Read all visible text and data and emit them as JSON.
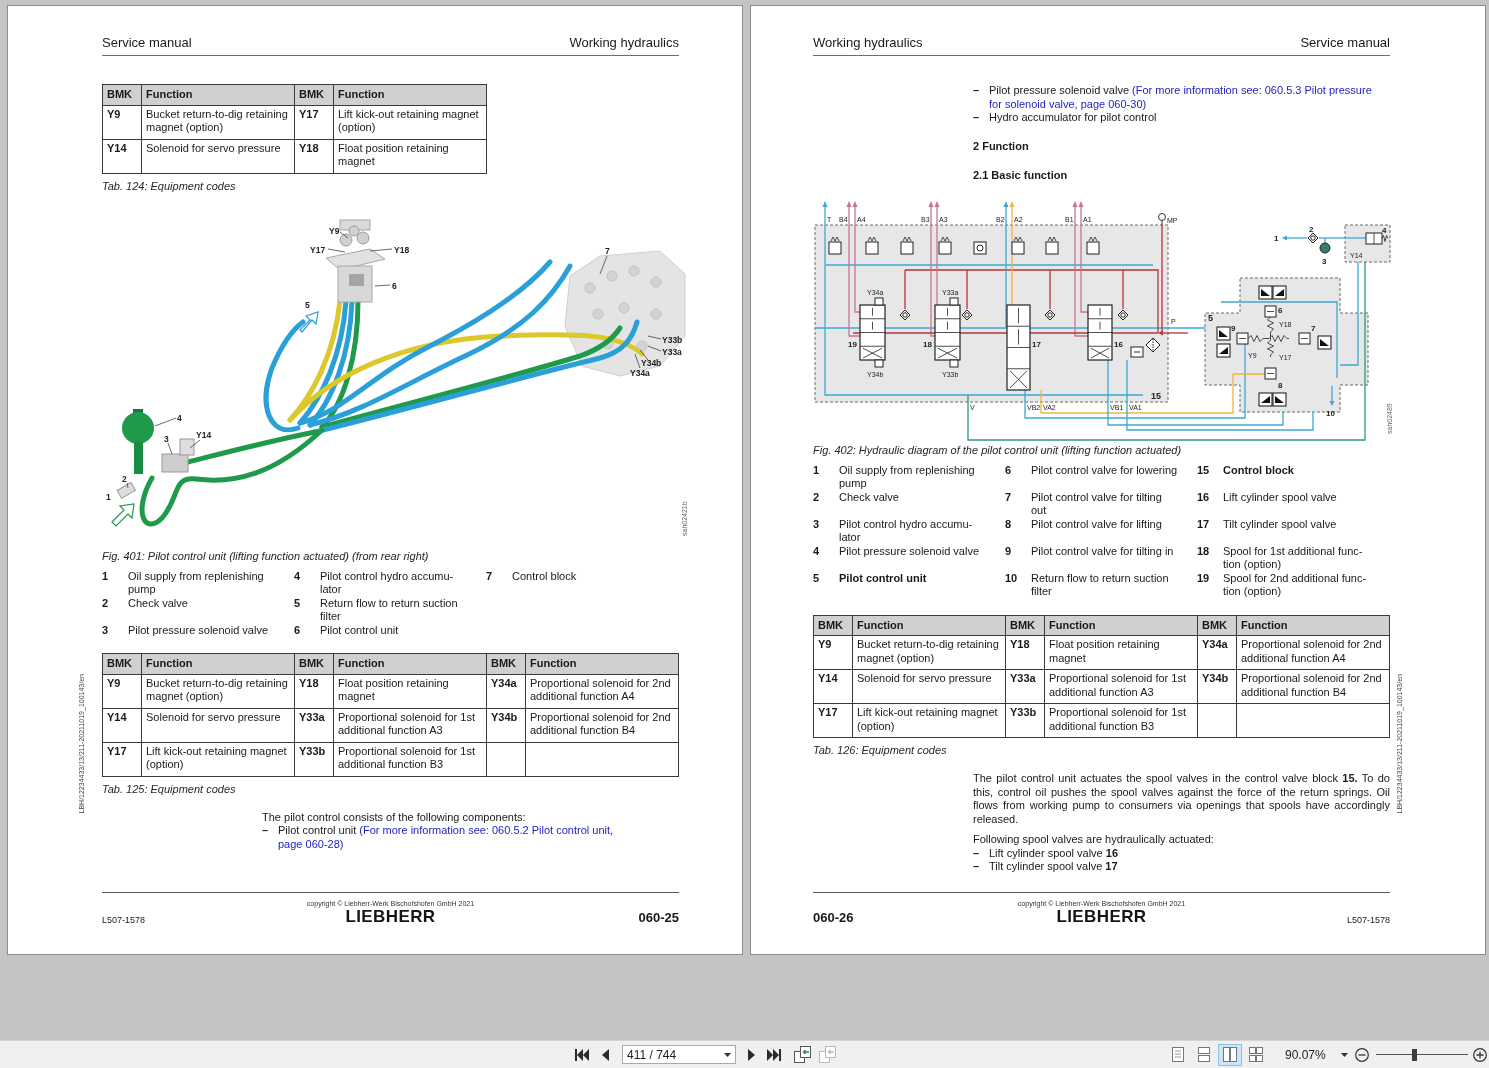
{
  "pages": [
    {
      "header": {
        "left": "Service manual",
        "right": "Working hydraulics"
      },
      "blocks": [
        {
          "kind": "table",
          "columns": [
            "BMK",
            "Function",
            "BMK",
            "Function"
          ],
          "rows": [
            [
              "Y9",
              "Bucket return-to-dig retaining magnet (option)",
              "Y17",
              "Lift kick-out retaining magnet (option)"
            ],
            [
              "Y14",
              "Solenoid for servo pressure",
              "Y18",
              "Float position retaining magnet"
            ]
          ]
        },
        {
          "kind": "caption",
          "text": "Tab. 124: Equipment codes"
        },
        {
          "kind": "illustration",
          "labels": [
            "1",
            "2",
            "3",
            "4",
            "5",
            "6",
            "7",
            "Y9",
            "Y14",
            "Y17",
            "Y18",
            "Y33a",
            "Y33b",
            "Y34a",
            "Y34b"
          ],
          "figure_id": "sah02421b"
        },
        {
          "kind": "caption",
          "text": "Fig. 401: Pilot control unit (lifting function actuated) (from rear right)"
        },
        {
          "kind": "legend",
          "columns": [
            [
              {
                "number": "1",
                "text": "Oil supply from replenishing pump",
                "bold": false
              },
              {
                "number": "2",
                "text": "Check valve",
                "bold": false
              },
              {
                "number": "3",
                "text": "Pilot pressure solenoid valve",
                "bold": false
              }
            ],
            [
              {
                "number": "4",
                "text": "Pilot control hydro accumu-lator",
                "bold": false
              },
              {
                "number": "5",
                "text": "Return flow to return suction filter",
                "bold": false
              },
              {
                "number": "6",
                "text": "Pilot control unit",
                "bold": false
              }
            ],
            [
              {
                "number": "7",
                "text": "Control block",
                "bold": false
              }
            ]
          ]
        },
        {
          "kind": "table",
          "columns": [
            "BMK",
            "Function",
            "BMK",
            "Function",
            "BMK",
            "Function"
          ],
          "rows": [
            [
              "Y9",
              "Bucket return-to-dig retaining magnet (option)",
              "Y18",
              "Float position retaining magnet",
              "Y34a",
              "Proportional solenoid for 2nd additional function A4"
            ],
            [
              "Y14",
              "Solenoid for servo pressure",
              "Y33a",
              "Proportional solenoid for 1st additional function A3",
              "Y34b",
              "Proportional solenoid for 2nd additional function B4"
            ],
            [
              "Y17",
              "Lift kick-out retaining magnet (option)",
              "Y33b",
              "Proportional solenoid for 1st additional function B3"
            ]
          ]
        },
        {
          "kind": "caption",
          "text": "Tab. 125: Equipment codes"
        },
        {
          "kind": "paragraph",
          "text": "The pilot control consists of the following components:"
        },
        {
          "kind": "bullets",
          "marker": "–",
          "items": [
            {
              "text": "Pilot control unit",
              "link_lines": [
                "(For more information see: 060.5.2 Pilot control unit,",
                "page 060-28)"
              ]
            }
          ]
        }
      ],
      "footer": {
        "copyright": "copyright © Liebherr-Werk Bischofshofen GmbH 2021",
        "logo": "LIEBHERR",
        "doc_number": "L507-1578",
        "page_number": "060-25"
      },
      "margin_note": "LBH/12234433/13/211-20211019_100143/en"
    },
    {
      "header": {
        "left": "Working hydraulics",
        "right": "Service manual"
      },
      "blocks": [
        {
          "kind": "bullets",
          "marker": "–",
          "items": [
            {
              "text": "Pilot pressure solenoid valve",
              "link_lines": [
                "(For more information see: 060.5.3 Pilot pressure",
                "for solenoid valve, page 060-30)"
              ]
            },
            {
              "text": "Hydro accumulator for pilot control"
            }
          ]
        },
        {
          "kind": "heading",
          "text": "2 Function"
        },
        {
          "kind": "heading",
          "text": "2.1 Basic function"
        },
        {
          "kind": "schematic",
          "labels": [
            "T",
            "B4",
            "A4",
            "B3",
            "A3",
            "B2",
            "A2",
            "B1",
            "A1",
            "MP",
            "Y34a",
            "Y33a",
            "19",
            "18",
            "17",
            "16",
            "P",
            "Y34b",
            "Y33b",
            "15",
            "V",
            "VB2",
            "VA2",
            "VB1",
            "VA1",
            "1",
            "2",
            "3",
            "4",
            "Y14",
            "5",
            "6",
            "Y18",
            "7",
            "8",
            "9",
            "Y9",
            "Y17",
            "10"
          ],
          "figure_id": "sah02489"
        },
        {
          "kind": "caption",
          "text": "Fig. 402: Hydraulic diagram of the pilot control unit (lifting function actuated)"
        },
        {
          "kind": "legend",
          "columns": [
            [
              {
                "number": "1",
                "text": "Oil supply from replenishing pump",
                "bold": false
              },
              {
                "number": "2",
                "text": "Check valve",
                "bold": false
              },
              {
                "number": "3",
                "text": "Pilot control hydro accumu-lator",
                "bold": false
              },
              {
                "number": "4",
                "text": "Pilot pressure solenoid valve",
                "bold": false
              },
              {
                "number": "5",
                "text": "Pilot control unit",
                "bold": true
              }
            ],
            [
              {
                "number": "6",
                "text": "Pilot control valve for lowering",
                "bold": false
              },
              {
                "number": "7",
                "text": "Pilot control valve for tilting out",
                "bold": false
              },
              {
                "number": "8",
                "text": "Pilot control valve for lifting",
                "bold": false
              },
              {
                "number": "9",
                "text": "Pilot control valve for tilting in",
                "bold": false
              },
              {
                "number": "10",
                "text": "Return flow to return suction filter",
                "bold": false
              }
            ],
            [
              {
                "number": "15",
                "text": "Control block",
                "bold": true
              },
              {
                "number": "16",
                "text": "Lift cylinder spool valve",
                "bold": false
              },
              {
                "number": "17",
                "text": "Tilt cylinder spool valve",
                "bold": false
              },
              {
                "number": "18",
                "text": "Spool for 1st additional func-tion (option)",
                "bold": false
              },
              {
                "number": "19",
                "text": "Spool for 2nd additional func-tion (option)",
                "bold": false
              }
            ]
          ]
        },
        {
          "kind": "table",
          "columns": [
            "BMK",
            "Function",
            "BMK",
            "Function",
            "BMK",
            "Function"
          ],
          "rows": [
            [
              "Y9",
              "Bucket return-to-dig retaining magnet (option)",
              "Y18",
              "Float position retaining magnet",
              "Y34a",
              "Proportional solenoid for 2nd additional function A4"
            ],
            [
              "Y14",
              "Solenoid for servo pressure",
              "Y33a",
              "Proportional solenoid for 1st additional function A3",
              "Y34b",
              "Proportional solenoid for 2nd additional function B4"
            ],
            [
              "Y17",
              "Lift kick-out retaining magnet (option)",
              "Y33b",
              "Proportional solenoid for 1st additional function B3"
            ]
          ]
        },
        {
          "kind": "caption",
          "text": "Tab. 126: Equipment codes"
        },
        {
          "kind": "paragraph",
          "text": "The pilot control unit actuates the spool valves in the control valve block **15.** To do this, control oil pushes the spool valves against the force of the return springs. Oil flows from working pump to consumers via openings that spools have accordingly released."
        },
        {
          "kind": "paragraph",
          "text": "Following spool valves are hydraulically actuated:"
        },
        {
          "kind": "bullets",
          "marker": "–",
          "items": [
            {
              "text": "Lift cylinder spool valve **16**"
            },
            {
              "text": "Tilt cylinder spool valve **17**"
            }
          ]
        }
      ],
      "footer": {
        "copyright": "copyright © Liebherr-Werk Bischofshofen GmbH 2021",
        "logo": "LIEBHERR",
        "doc_number": "L507-1578",
        "page_number": "060-26"
      },
      "margin_note": "LBH/12234433/13/211-20211019_100143/en"
    }
  ],
  "toolbar": {
    "page_field": {
      "value": "411 / 744"
    },
    "history_buttons": [
      {
        "disabled": false
      },
      {
        "disabled": true
      }
    ],
    "view_modes": [
      {
        "kind": "single",
        "selected": false
      },
      {
        "kind": "continuous",
        "selected": false
      },
      {
        "kind": "facing",
        "selected": true
      },
      {
        "kind": "continuous-facing",
        "selected": false
      }
    ],
    "zoom_field": {
      "value": "90.07%"
    },
    "zoom_slider": {
      "level": 0.42
    }
  }
}
